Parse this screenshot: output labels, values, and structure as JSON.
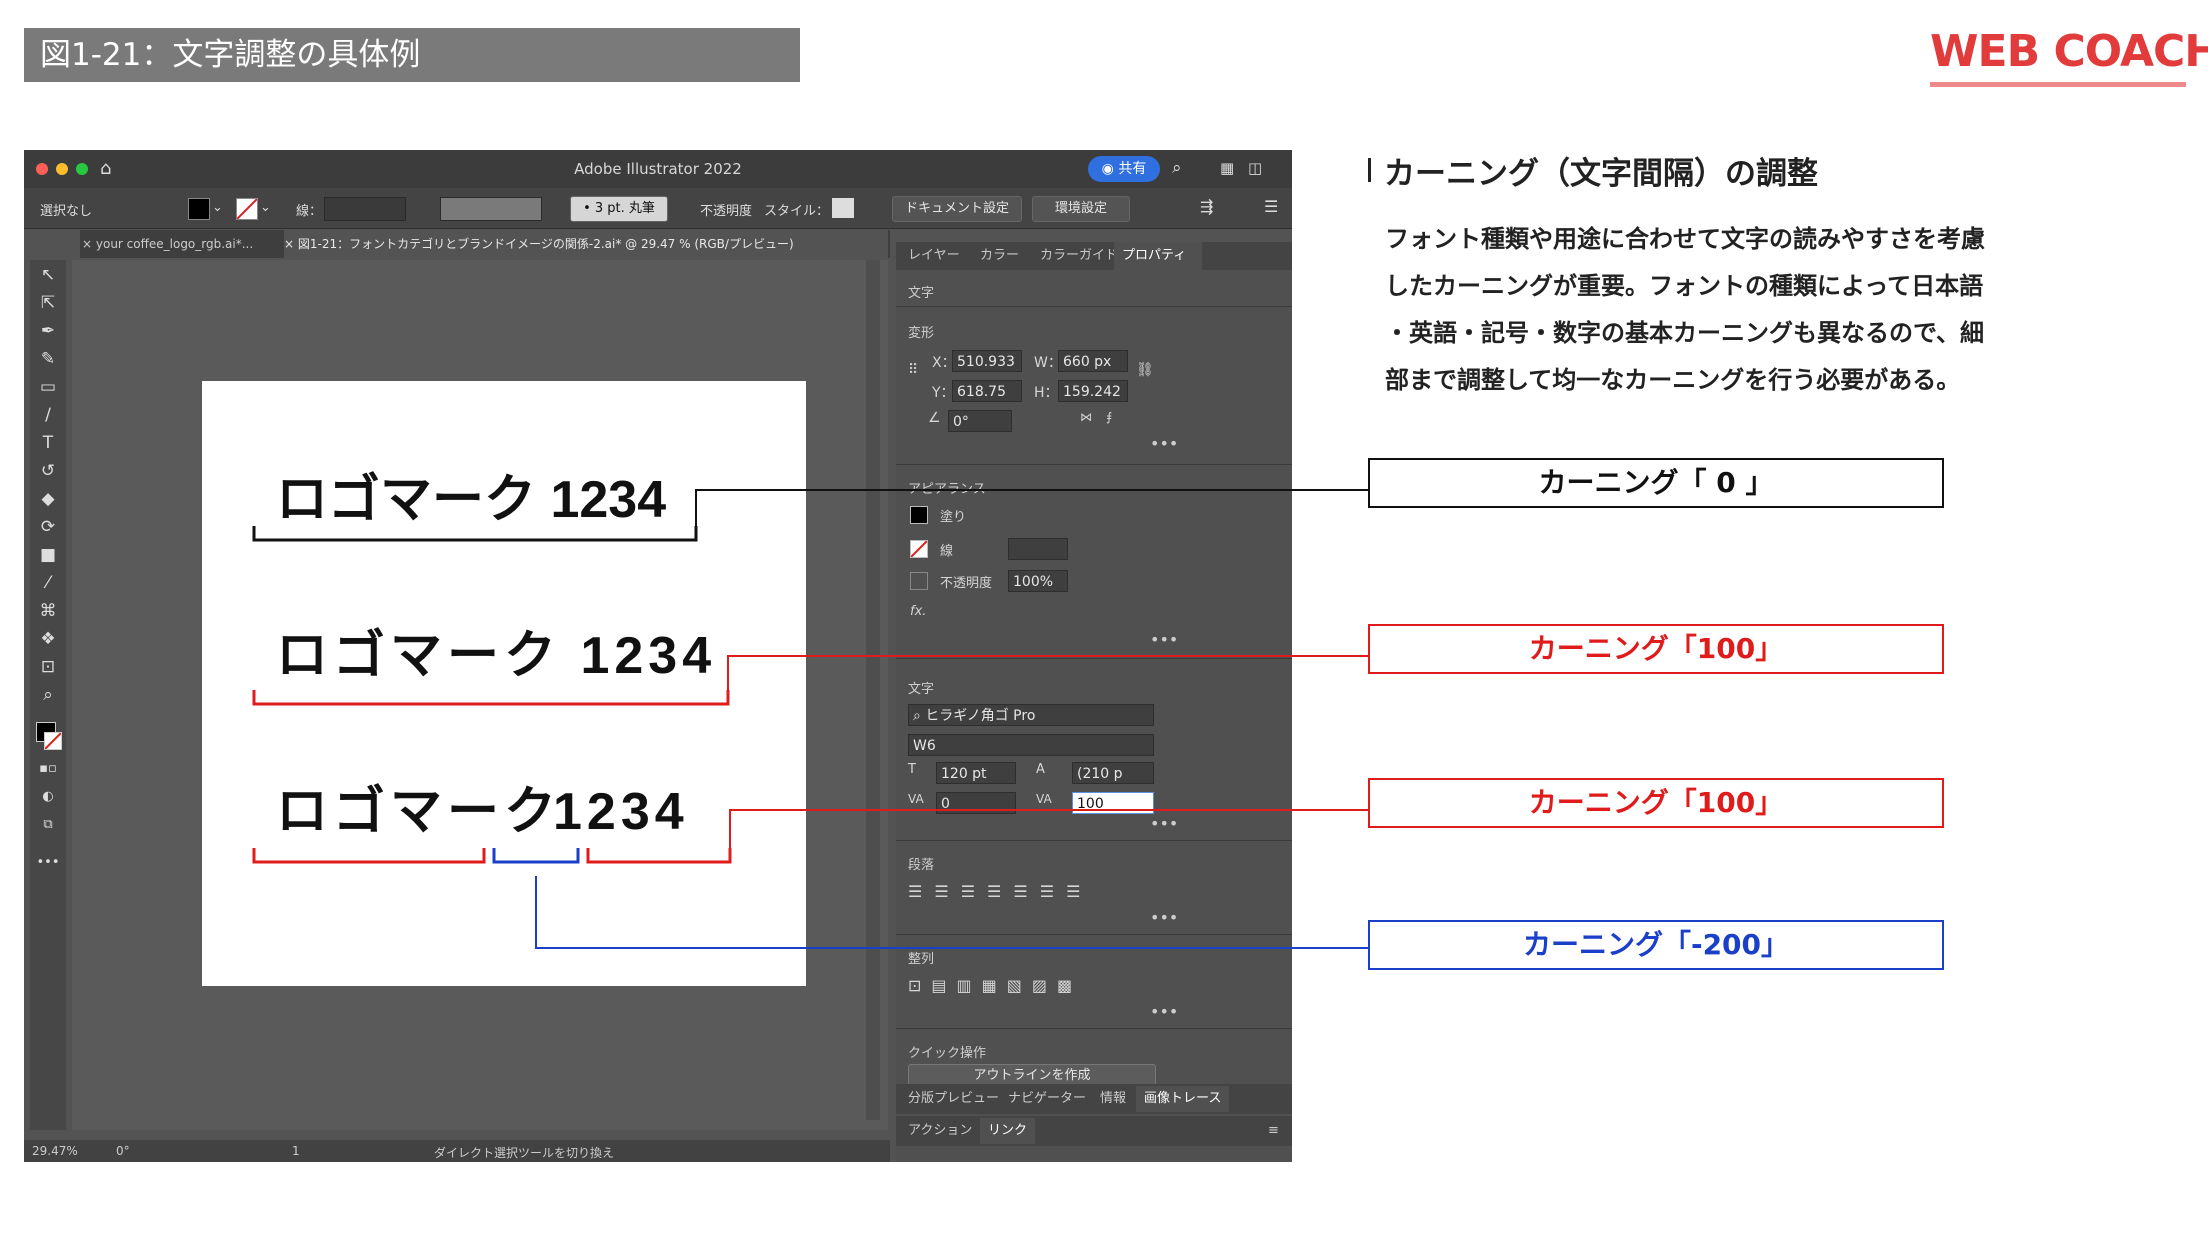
{
  "figure_title": "図1-21：文字調整の具体例",
  "brand": {
    "logo_text": "WEB COACH",
    "color": "#e23b3b"
  },
  "app": {
    "window_title": "Adobe Illustrator 2022",
    "share_label": "共有",
    "control_bar": {
      "selection": "選択なし",
      "stroke_label": "線：",
      "brush": "• 3 pt. 丸筆",
      "opacity_label": "不透明度",
      "style_label": "スタイル：",
      "document_settings": "ドキュメント設定",
      "preferences": "環境設定"
    },
    "tabs": [
      {
        "label": "× your coffee_logo_rgb.ai*..."
      },
      {
        "label": "× 図1-21：フォントカテゴリとブランドイメージの関係-2.ai* @ 29.47 % (RGB/プレビュー)"
      }
    ],
    "artboard_samples": [
      {
        "text": "ロゴマーク 1234"
      },
      {
        "text": "ロゴマーク 1234"
      },
      {
        "text_kana": "ロゴマーク",
        "text_num": "1234"
      }
    ],
    "status_bar": {
      "zoom": "29.47%",
      "rotation": "0°",
      "page": "1",
      "tool_hint": "ダイレクト選択ツールを切り換え"
    },
    "panel": {
      "tabs": [
        "レイヤー",
        "カラー",
        "カラーガイド",
        "プロパティ"
      ],
      "active_tab": "プロパティ",
      "section_char": "文字",
      "transform": {
        "title": "変形",
        "x_label": "X：",
        "x": "510.933",
        "y_label": "Y：",
        "y": "618.75",
        "w_label": "W：",
        "w": "660 px",
        "h_label": "H：",
        "h": "159.242",
        "angle": "0°"
      },
      "appearance": {
        "title": "アピアランス",
        "fill": "塗り",
        "stroke": "線",
        "opacity_label": "不透明度",
        "opacity": "100%",
        "fx": "fx."
      },
      "character": {
        "title": "文字",
        "font": "ヒラギノ角ゴ Pro",
        "weight": "W6",
        "size": "120 pt",
        "leading": "(210 p",
        "tracking": "0",
        "kerning": "100"
      },
      "paragraph": {
        "title": "段落"
      },
      "align": {
        "title": "整列"
      },
      "quick_actions": {
        "title": "クイック操作",
        "outline_button": "アウトラインを作成"
      },
      "bottom_tabs_1": [
        "分版プレビュー",
        "ナビゲーター",
        "情報",
        "画像トレース"
      ],
      "bottom_tabs_2": [
        "アクション",
        "リンク"
      ]
    }
  },
  "explanation": {
    "heading": "カーニング（文字間隔）の調整",
    "lines": [
      "フォント種類や用途に合わせて文字の読みやすさを考慮",
      "したカーニングが重要。フォントの種類によって日本語",
      "・英語・記号・数字の基本カーニングも異なるので、細",
      "部まで調整して均一なカーニングを行う必要がある。"
    ]
  },
  "callouts": [
    {
      "label": "カーニング「 0 」",
      "color": "#111111"
    },
    {
      "label": "カーニング「100」",
      "color": "#e01b1b"
    },
    {
      "label": "カーニング「100」",
      "color": "#e01b1b"
    },
    {
      "label": "カーニング「-200」",
      "color": "#1a3fc8"
    }
  ]
}
